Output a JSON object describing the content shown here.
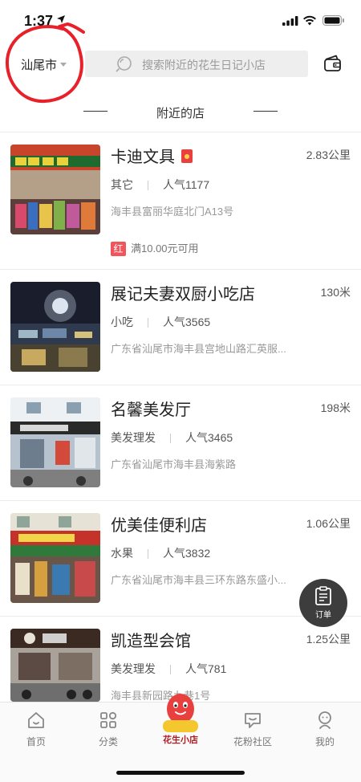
{
  "status": {
    "time": "1:37"
  },
  "header": {
    "city": "汕尾市",
    "search_placeholder": "搜索附近的花生日记小店"
  },
  "section": {
    "title": "附近的店"
  },
  "stores": [
    {
      "name": "卡迪文具",
      "distance": "2.83公里",
      "category": "其它",
      "popularity": "人气1177",
      "address": "海丰县富丽华庭北门A13号",
      "coupon_tag": "红",
      "coupon_text": "满10.00元可用",
      "has_hongbao": true
    },
    {
      "name": "展记夫妻双厨小吃店",
      "distance": "130米",
      "category": "小吃",
      "popularity": "人气3565",
      "address": "广东省汕尾市海丰县宫地山路汇英服..."
    },
    {
      "name": "名馨美发厅",
      "distance": "198米",
      "category": "美发理发",
      "popularity": "人气3465",
      "address": "广东省汕尾市海丰县海紫路"
    },
    {
      "name": "优美佳便利店",
      "distance": "1.06公里",
      "category": "水果",
      "popularity": "人气3832",
      "address": "广东省汕尾市海丰县三环东路东盛小..."
    },
    {
      "name": "凯造型会馆",
      "distance": "1.25公里",
      "category": "美发理发",
      "popularity": "人气781",
      "address": "海丰县新园路九巷1号"
    }
  ],
  "fab": {
    "label": "订单"
  },
  "tabbar": {
    "items": [
      {
        "label": "首页"
      },
      {
        "label": "分类"
      },
      {
        "label": "花生小店"
      },
      {
        "label": "花粉社区"
      },
      {
        "label": "我的"
      }
    ]
  },
  "colors": {
    "accent_red": "#e8403f",
    "annotation_red": "#e8202a",
    "tab_logo_yellow": "#f5c72e"
  }
}
